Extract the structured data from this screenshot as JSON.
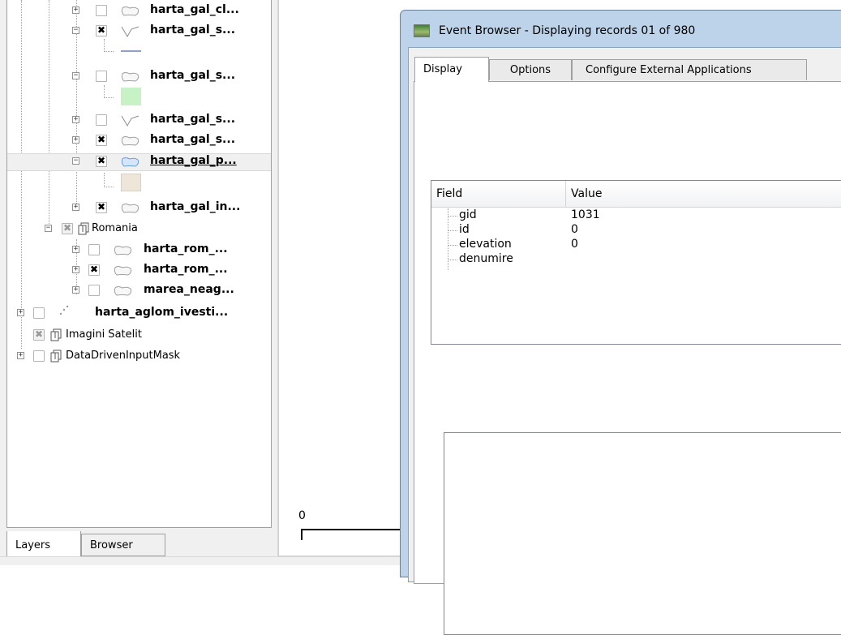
{
  "layers_panel": {
    "rows": [
      {
        "label": "harta_gal_cl...",
        "bold": true,
        "checked": "off",
        "icon": "polygon"
      },
      {
        "label": "harta_gal_s...",
        "bold": true,
        "checked": "on",
        "icon": "line"
      },
      {
        "label": "harta_gal_s...",
        "bold": true,
        "checked": "off",
        "icon": "polygon"
      },
      {
        "label": "harta_gal_s...",
        "bold": true,
        "checked": "off",
        "icon": "line"
      },
      {
        "label": "harta_gal_s...",
        "bold": true,
        "checked": "on",
        "icon": "polygon"
      },
      {
        "label": "harta_gal_p...",
        "bold": true,
        "checked": "on",
        "icon": "polygon-blue",
        "selected": true
      },
      {
        "label": "harta_gal_in...",
        "bold": true,
        "checked": "on",
        "icon": "polygon"
      },
      {
        "label": "Romania",
        "bold": false,
        "checked": "partial",
        "icon": "group"
      },
      {
        "label": "harta_rom_...",
        "bold": true,
        "checked": "off",
        "icon": "polygon"
      },
      {
        "label": "harta_rom_...",
        "bold": true,
        "checked": "on",
        "icon": "polygon"
      },
      {
        "label": "marea_neag...",
        "bold": true,
        "checked": "off",
        "icon": "polygon"
      },
      {
        "label": "harta_aglom_ivesti...",
        "bold": true,
        "checked": "off",
        "icon": "points"
      },
      {
        "label": "Imagini Satelit",
        "bold": false,
        "checked": "partial",
        "icon": "group"
      },
      {
        "label": "DataDrivenInputMask",
        "bold": false,
        "checked": "off",
        "icon": "group"
      }
    ],
    "swatch_colors": {
      "line": "#8ea3c4",
      "green": "#c6f2c6",
      "beige": "#efe6da"
    },
    "tabs": {
      "layers": "Layers",
      "browser": "Browser"
    }
  },
  "map": {
    "scale_label": "0"
  },
  "event_browser": {
    "title": "Event Browser - Displaying records 01 of 980",
    "tabs": {
      "display": "Display",
      "options": "Options",
      "external": "Configure External Applications"
    },
    "table": {
      "headers": {
        "field": "Field",
        "value": "Value"
      },
      "rows": [
        {
          "field": "gid",
          "value": "1031"
        },
        {
          "field": "id",
          "value": "0"
        },
        {
          "field": "elevation",
          "value": "0"
        },
        {
          "field": "denumire",
          "value": ""
        }
      ]
    }
  }
}
